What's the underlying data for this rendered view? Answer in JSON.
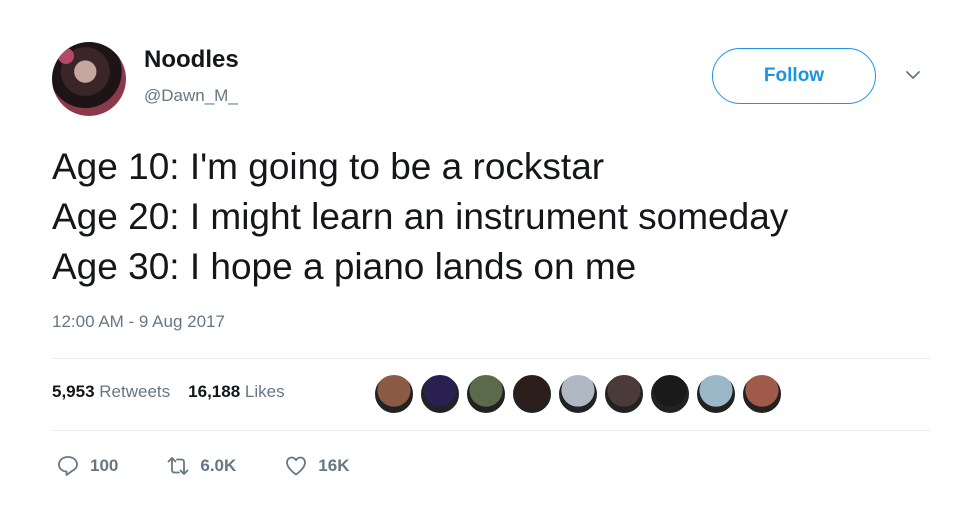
{
  "author": {
    "display_name": "Noodles",
    "handle": "@Dawn_M_"
  },
  "follow_label": "Follow",
  "tweet": {
    "lines": [
      "Age 10: I'm going to be a rockstar",
      "Age 20: I might learn an instrument someday",
      "Age 30: I hope a piano lands on me"
    ],
    "timestamp": "12:00 AM - 9 Aug 2017"
  },
  "stats": {
    "retweets_count": "5,953",
    "retweets_label": "Retweets",
    "likes_count": "16,188",
    "likes_label": "Likes"
  },
  "liker_avatars": [
    {
      "color": "#8a5a44"
    },
    {
      "color": "#2a2050"
    },
    {
      "color": "#5a6a4a"
    },
    {
      "color": "#2b1e1a"
    },
    {
      "color": "#b0b8c4"
    },
    {
      "color": "#4a3a3a"
    },
    {
      "color": "#1a1a1a"
    },
    {
      "color": "#9ab8c8"
    },
    {
      "color": "#a05a4a"
    }
  ],
  "actions": {
    "reply_count": "100",
    "retweet_count": "6.0K",
    "like_count": "16K"
  },
  "colors": {
    "accent": "#1b95e0",
    "muted": "#657786",
    "text": "#14171a"
  }
}
